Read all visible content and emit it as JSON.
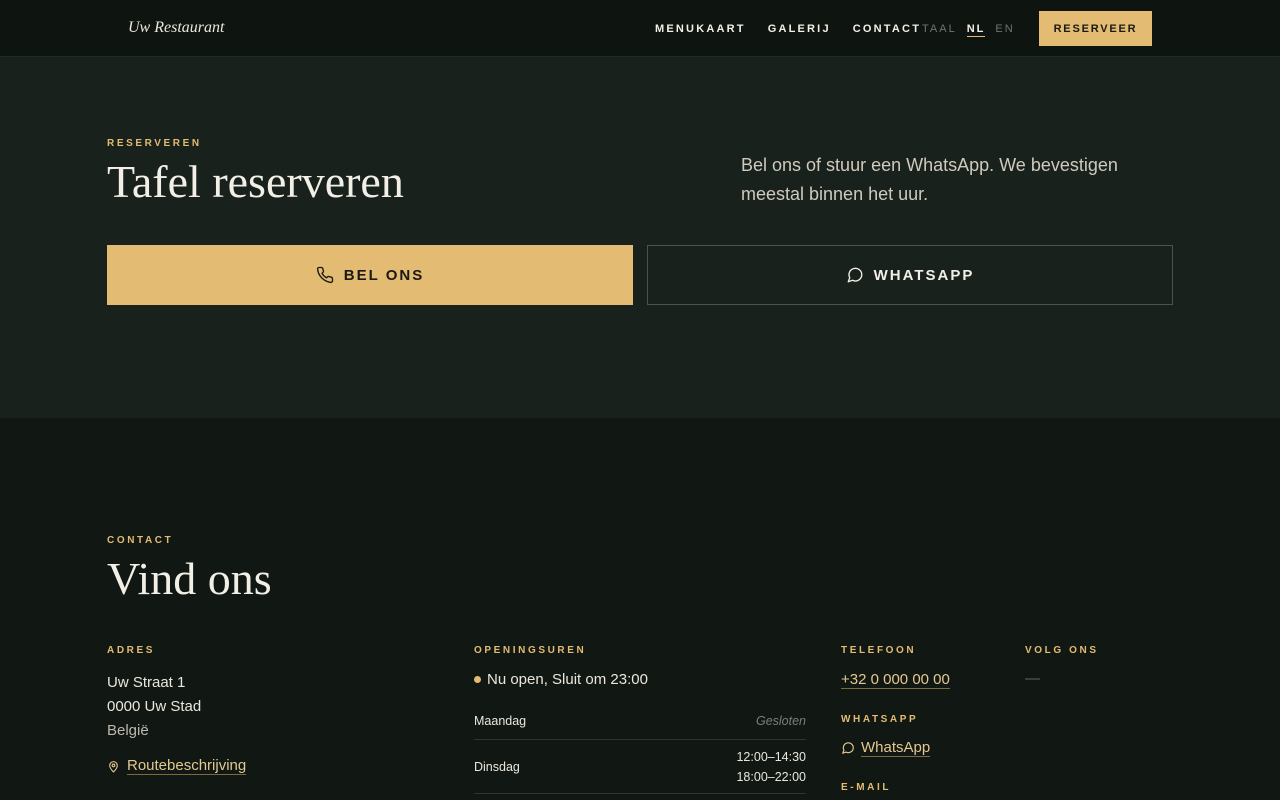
{
  "nav": {
    "brand": "Uw Restaurant",
    "links": [
      "MENUKAART",
      "GALERIJ",
      "CONTACT"
    ],
    "lang_label": "TAAL",
    "lang_active": "NL",
    "lang_other": "EN",
    "reserve": "RESERVEER"
  },
  "hero": {
    "eyebrow": "RESERVEREN",
    "title": "Tafel reserveren",
    "text": "Bel ons of stuur een WhatsApp. We bevestigen meestal binnen het uur.",
    "call_label": "BEL ONS",
    "wa_label": "WHATSAPP"
  },
  "contact": {
    "eyebrow": "CONTACT",
    "title": "Vind ons",
    "address": {
      "label": "ADRES",
      "line1": "Uw Straat 1",
      "line2": "0000 Uw Stad",
      "country": "België",
      "route": "Routebeschrijving"
    },
    "hours": {
      "label": "OPENINGSUREN",
      "status": "Nu open, Sluit om 23:00",
      "rows": [
        {
          "day": "Maandag",
          "value": "Gesloten"
        },
        {
          "day": "Dinsdag",
          "value1": "12:00–14:30",
          "value2": "18:00–22:00"
        }
      ]
    },
    "phone": {
      "label": "TELEFOON",
      "number": "+32 0 000 00 00",
      "wa_label": "WHATSAPP",
      "wa_link": "WhatsApp",
      "mail_label": "E-MAIL"
    },
    "social": {
      "label": "VOLG ONS",
      "value": "—"
    }
  },
  "colors": {
    "accent": "#e3bb72",
    "background": "#111814",
    "hero_bg": "#18211c"
  }
}
